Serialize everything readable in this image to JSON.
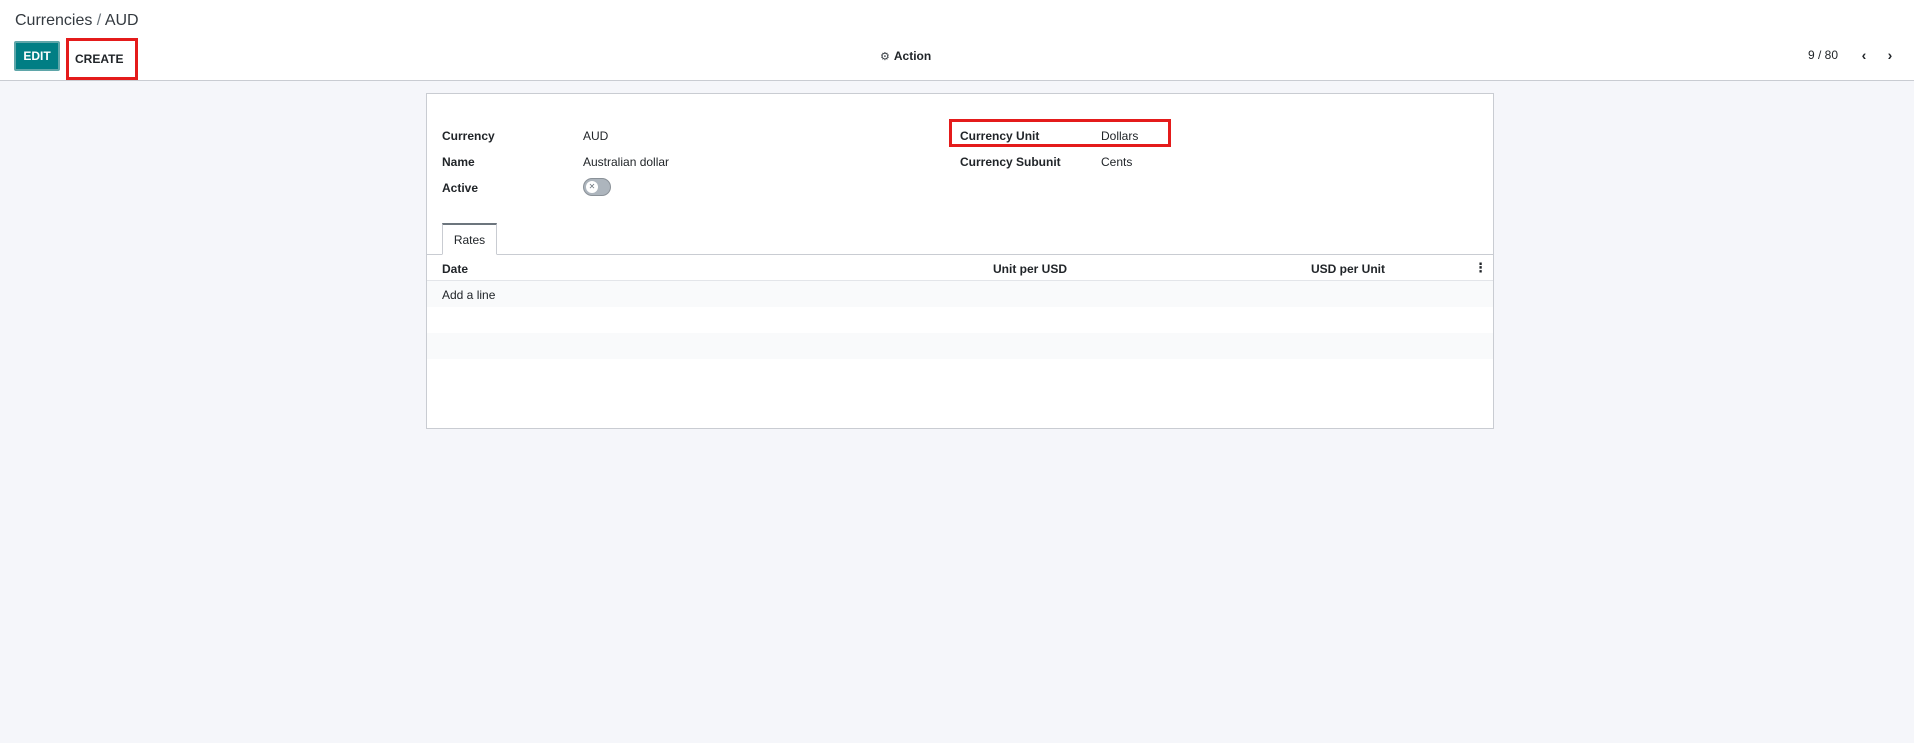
{
  "breadcrumb": {
    "parent": "Currencies",
    "separator": " / ",
    "current": "AUD"
  },
  "toolbar": {
    "edit_label": "EDIT",
    "create_label": "CREATE",
    "action_label": "Action"
  },
  "pager": {
    "value": "9 / 80"
  },
  "form": {
    "currency_label": "Currency",
    "currency_value": "AUD",
    "name_label": "Name",
    "name_value": "Australian dollar",
    "active_label": "Active",
    "active": false,
    "unit_label": "Currency Unit",
    "unit_value": "Dollars",
    "subunit_label": "Currency Subunit",
    "subunit_value": "Cents"
  },
  "tabs": [
    {
      "label": "Rates"
    }
  ],
  "rates_table": {
    "columns": [
      "Date",
      "Unit per USD",
      "USD per Unit"
    ],
    "add_line_label": "Add a line",
    "rows": []
  },
  "colors": {
    "accent": "#017e84",
    "highlight": "#e41b1b",
    "background": "#f5f6fa"
  }
}
